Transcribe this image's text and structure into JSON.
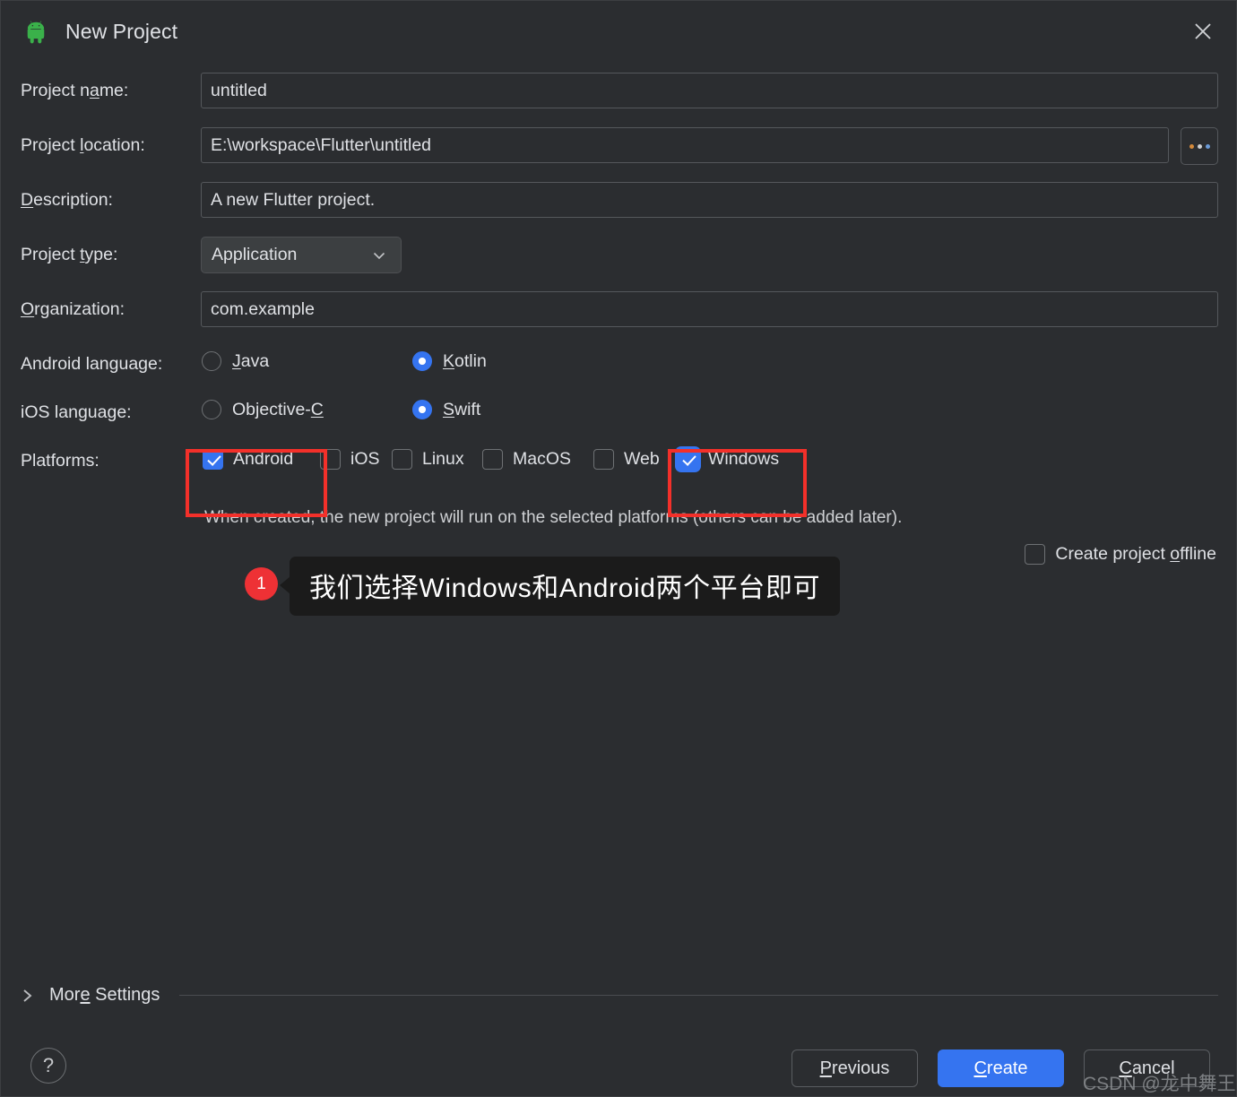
{
  "window": {
    "title": "New Project",
    "app_icon": "android-icon",
    "close_icon": "close-icon"
  },
  "form": {
    "project_name": {
      "label": "Project name:",
      "mnemonic": "a",
      "value": "untitled"
    },
    "project_location": {
      "label": "Project location:",
      "mnemonic": "l",
      "value": "E:\\workspace\\Flutter\\untitled",
      "browse_label": "..."
    },
    "description": {
      "label": "Description:",
      "mnemonic": "D",
      "value": "A new Flutter project."
    },
    "project_type": {
      "label": "Project type:",
      "mnemonic": "t",
      "value": "Application",
      "options": [
        "Application"
      ]
    },
    "organization": {
      "label": "Organization:",
      "mnemonic": "O",
      "value": "com.example"
    }
  },
  "android_language": {
    "label": "Android language:",
    "options": [
      {
        "label": "Java",
        "mnemonic": "J",
        "selected": false
      },
      {
        "label": "Kotlin",
        "mnemonic": "K",
        "selected": true
      }
    ]
  },
  "ios_language": {
    "label": "iOS language:",
    "options": [
      {
        "label": "Objective-C",
        "mnemonic": "C",
        "selected": false
      },
      {
        "label": "Swift",
        "mnemonic": "S",
        "selected": true
      }
    ]
  },
  "platforms": {
    "label": "Platforms:",
    "items": [
      {
        "label": "Android",
        "checked": true
      },
      {
        "label": "iOS",
        "checked": false
      },
      {
        "label": "Linux",
        "checked": false
      },
      {
        "label": "MacOS",
        "checked": false
      },
      {
        "label": "Web",
        "checked": false
      },
      {
        "label": "Windows",
        "checked": true
      }
    ],
    "hint": "When created, the new project will run on the selected platforms (others can be added later)."
  },
  "offline": {
    "label": "Create project offline",
    "mnemonic": "o",
    "checked": false
  },
  "annotation": {
    "number": "1",
    "text": "我们选择Windows和Android两个平台即可"
  },
  "more_settings": {
    "label": "More Settings",
    "mnemonic": "e",
    "chevron_icon": "chevron-right-icon",
    "expanded": false
  },
  "footer": {
    "help_label": "?",
    "previous_label": "Previous",
    "previous_mnemonic": "P",
    "create_label": "Create",
    "create_mnemonic": "C",
    "cancel_label": "Cancel",
    "cancel_mnemonic": "C"
  },
  "watermark": "CSDN @龙中舞王",
  "colors": {
    "dialog_bg": "#2b2d30",
    "accent": "#3574f0",
    "highlight_red": "#f3302a",
    "badge_red": "#ee3135",
    "android_green": "#3ddc84",
    "text": "#dfe1e5"
  }
}
